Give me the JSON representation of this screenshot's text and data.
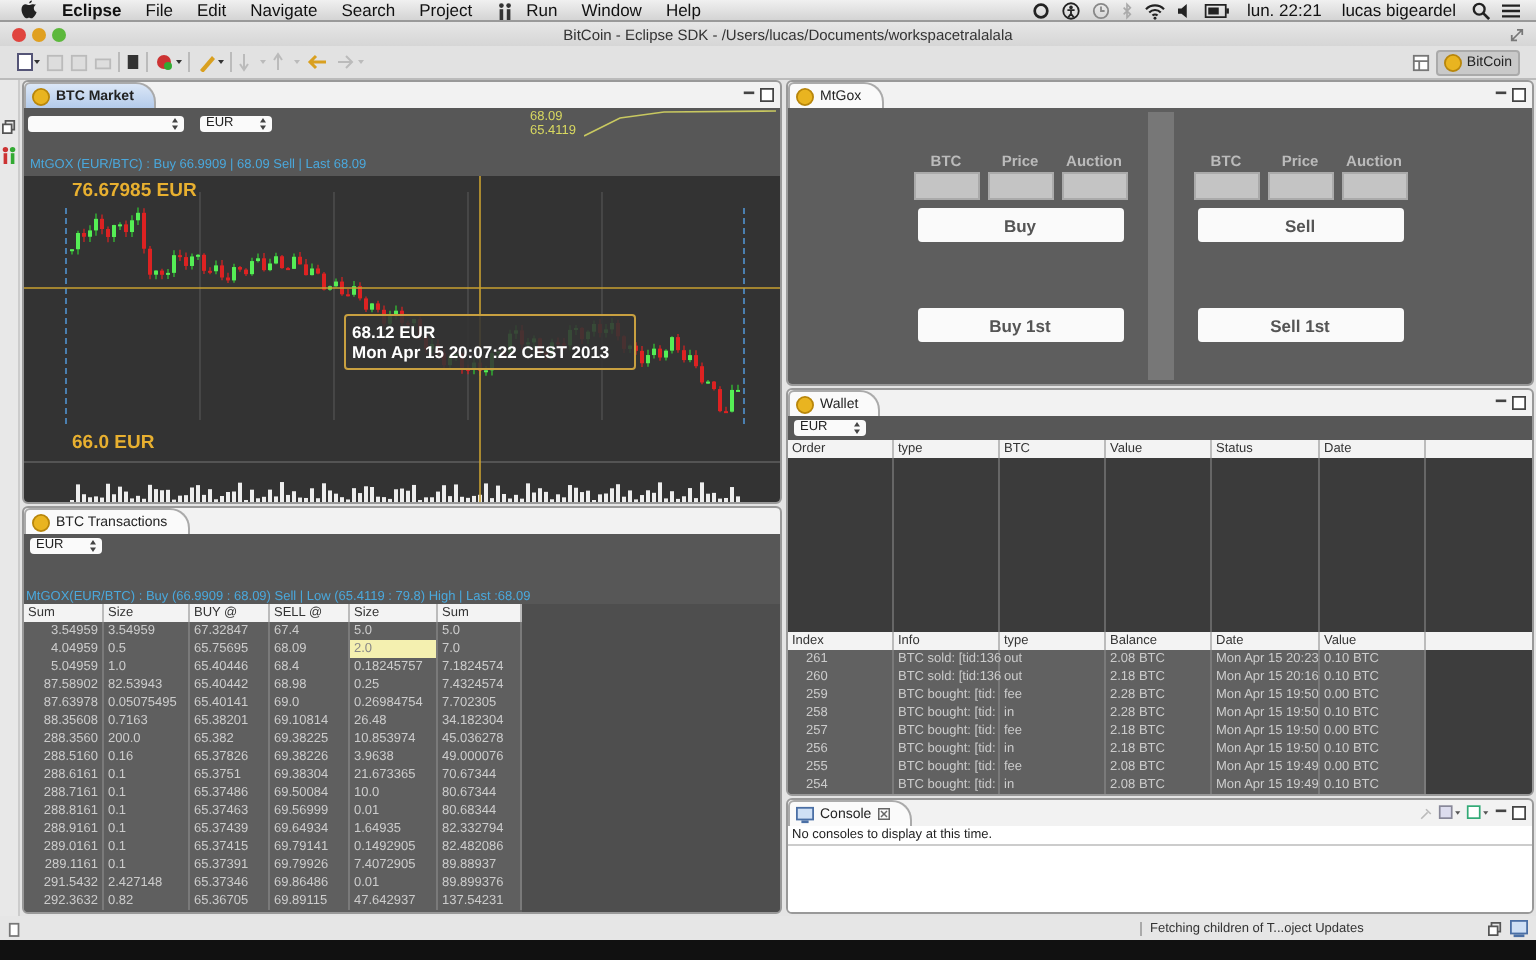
{
  "menubar": {
    "app": "Eclipse",
    "items": [
      {
        "kind": "menu",
        "label": "File"
      },
      {
        "kind": "menu",
        "label": "Edit"
      },
      {
        "kind": "menu",
        "label": "Navigate"
      },
      {
        "kind": "menu",
        "label": "Search"
      },
      {
        "kind": "menu",
        "label": "Project"
      },
      {
        "kind": "icon"
      },
      {
        "kind": "menu",
        "label": "Run"
      },
      {
        "kind": "menu",
        "label": "Window"
      },
      {
        "kind": "menu",
        "label": "Help"
      }
    ],
    "clock": "lun. 22:21",
    "user": "lucas bigeardel"
  },
  "window": {
    "title": "BitCoin - Eclipse SDK - /Users/lucas/Documents/workspacetralalala",
    "perspective": {
      "label": "BitCoin",
      "selected": true
    }
  },
  "market": {
    "tab": {
      "label": "BTC Market",
      "selected": true
    },
    "currency": "EUR",
    "spark_high": "68.09",
    "spark_low": "65.4119",
    "ticker": "MtGOX (EUR/BTC) : Buy 66.9909 | 68.09 Sell | Last 68.09",
    "high_label": "76.67985 EUR",
    "low_label": "66.0 EUR",
    "tooltip": {
      "price": "68.12 EUR",
      "date": "Mon Apr 15 20:07:22 CEST 2013"
    }
  },
  "transactions": {
    "tab": {
      "label": "BTC Transactions",
      "selected": false
    },
    "currency": "EUR",
    "ticker": "MtGOX(EUR/BTC) : Buy (66.9909 : 68.09) Sell | Low (65.4119 : 79.8) High | Last :68.09",
    "columns": [
      "Sum",
      "Size",
      "BUY @",
      "SELL @",
      "Size",
      "Sum"
    ],
    "rows": [
      [
        "3.54959",
        "3.54959",
        "67.32847",
        "67.4",
        "5.0",
        "5.0"
      ],
      [
        "4.04959",
        "0.5",
        "65.75695",
        "68.09",
        {
          "text": "2.0",
          "selected": true
        },
        "7.0"
      ],
      [
        "5.04959",
        "1.0",
        "65.40446",
        "68.4",
        "0.18245757",
        "7.1824574"
      ],
      [
        "87.58902",
        "82.53943",
        "65.40442",
        "68.98",
        "0.25",
        "7.4324574"
      ],
      [
        "87.63978",
        "0.05075495",
        "65.40141",
        "69.0",
        "0.26984754",
        "7.702305"
      ],
      [
        "88.35608",
        "0.7163",
        "65.38201",
        "69.10814",
        "26.48",
        "34.182304"
      ],
      [
        "288.3560",
        "200.0",
        "65.382",
        "69.38225",
        "10.853974",
        "45.036278"
      ],
      [
        "288.5160",
        "0.16",
        "65.37826",
        "69.38226",
        "3.9638",
        "49.000076"
      ],
      [
        "288.6161",
        "0.1",
        "65.3751",
        "69.38304",
        "21.673365",
        "70.67344"
      ],
      [
        "288.7161",
        "0.1",
        "65.37486",
        "69.50084",
        "10.0",
        "80.67344"
      ],
      [
        "288.8161",
        "0.1",
        "65.37463",
        "69.56999",
        "0.01",
        "80.68344"
      ],
      [
        "288.9161",
        "0.1",
        "65.37439",
        "69.64934",
        "1.64935",
        "82.332794"
      ],
      [
        "289.0161",
        "0.1",
        "65.37415",
        "69.79141",
        "0.1492905",
        "82.482086"
      ],
      [
        "289.1161",
        "0.1",
        "65.37391",
        "69.79926",
        "7.4072905",
        "89.88937"
      ],
      [
        "291.5432",
        "2.427148",
        "65.37346",
        "69.86486",
        "0.01",
        "89.899376"
      ],
      [
        "292.3632",
        "0.82",
        "65.36705",
        "69.89115",
        "47.642937",
        "137.54231"
      ]
    ]
  },
  "mtgox": {
    "tab": {
      "label": "MtGox",
      "selected": false
    },
    "sides": [
      {
        "fields": [
          "BTC",
          "Price",
          "Auction"
        ],
        "action": "Buy",
        "first": "Buy 1st"
      },
      {
        "fields": [
          "BTC",
          "Price",
          "Auction"
        ],
        "action": "Sell",
        "first": "Sell 1st"
      }
    ]
  },
  "wallet": {
    "tab": {
      "label": "Wallet",
      "selected": false
    },
    "currency": "EUR",
    "order_columns": [
      "Order",
      "type",
      "BTC",
      "Value",
      "Status",
      "Date"
    ],
    "history_columns": [
      "Index",
      "Info",
      "type",
      "Balance",
      "Date",
      "Value"
    ],
    "history": [
      [
        "261",
        "BTC sold: [tid:136",
        "out",
        "2.08 BTC",
        "Mon Apr 15 20:23",
        "0.10 BTC"
      ],
      [
        "260",
        "BTC sold: [tid:136",
        "out",
        "2.18 BTC",
        "Mon Apr 15 20:16",
        "0.10 BTC"
      ],
      [
        "259",
        "BTC bought: [tid:",
        "fee",
        "2.28 BTC",
        "Mon Apr 15 19:50",
        "0.00 BTC"
      ],
      [
        "258",
        "BTC bought: [tid:",
        "in",
        "2.28 BTC",
        "Mon Apr 15 19:50",
        "0.10 BTC"
      ],
      [
        "257",
        "BTC bought: [tid:",
        "fee",
        "2.18 BTC",
        "Mon Apr 15 19:50",
        "0.00 BTC"
      ],
      [
        "256",
        "BTC bought: [tid:",
        "in",
        "2.18 BTC",
        "Mon Apr 15 19:50",
        "0.10 BTC"
      ],
      [
        "255",
        "BTC bought: [tid:",
        "fee",
        "2.08 BTC",
        "Mon Apr 15 19:49",
        "0.00 BTC"
      ],
      [
        "254",
        "BTC bought: [tid:",
        "in",
        "2.08 BTC",
        "Mon Apr 15 19:49",
        "0.10 BTC"
      ]
    ]
  },
  "console": {
    "tab": {
      "label": "Console",
      "selected": false
    },
    "message": "No consoles to display at this time."
  },
  "status_bar": {
    "task": "Fetching children of T...oject Updates"
  }
}
